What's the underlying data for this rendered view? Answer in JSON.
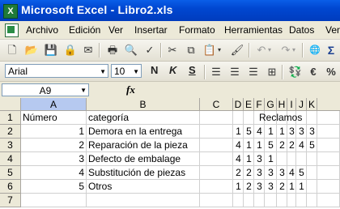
{
  "window": {
    "title": "Microsoft Excel - Libro2.xls"
  },
  "menu": [
    "Archivo",
    "Edición",
    "Ver",
    "Insertar",
    "Formato",
    "Herramientas",
    "Datos",
    "Ven"
  ],
  "toolbar_format": {
    "font": "Arial",
    "size": "10",
    "bold": "N",
    "italic": "K",
    "underline": "S"
  },
  "namebox": "A9",
  "fx": "fx",
  "columns": [
    "A",
    "B",
    "C",
    "D",
    "E",
    "F",
    "G",
    "H",
    "I",
    "J",
    "K"
  ],
  "rows": [
    "1",
    "2",
    "3",
    "4",
    "5",
    "6",
    "7"
  ],
  "cells": {
    "A1": "Número",
    "B1": "categoría",
    "D1": "Reclamos",
    "A2": "1",
    "B2": "Demora en la entrega",
    "A3": "2",
    "B3": "Reparación de la pieza",
    "A4": "3",
    "B4": "Defecto de embalage",
    "A5": "4",
    "B5": "Substitución de piezas",
    "A6": "5",
    "B6": "Otros",
    "r2": [
      "1",
      "5",
      "4",
      "1",
      "1",
      "3",
      "3",
      "3"
    ],
    "r3": [
      "4",
      "1",
      "1",
      "5",
      "2",
      "2",
      "4",
      "5"
    ],
    "r4": [
      "4",
      "1",
      "3",
      "1",
      "",
      "",
      "",
      ""
    ],
    "r5": [
      "2",
      "2",
      "3",
      "3",
      "3",
      "4",
      "5",
      ""
    ],
    "r6": [
      "1",
      "2",
      "3",
      "3",
      "2",
      "1",
      "1",
      ""
    ]
  }
}
